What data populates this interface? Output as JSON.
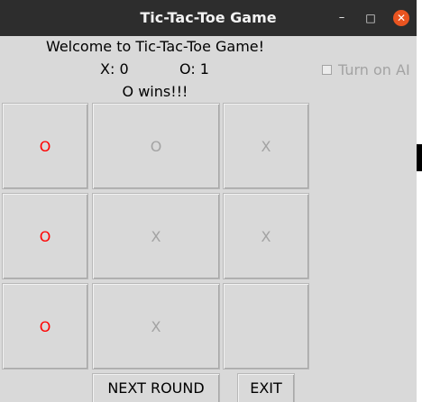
{
  "window": {
    "title": "Tic-Tac-Toe Game",
    "controls": {
      "minimize": "–",
      "maximize": "□",
      "close": "✕"
    }
  },
  "header": {
    "welcome": "Welcome to Tic-Tac-Toe Game!",
    "x_score": "X: 0",
    "o_score": "O: 1",
    "result": "O wins!!!"
  },
  "ai_toggle": {
    "label": "Turn on AI",
    "checked": false
  },
  "board": {
    "cells": [
      {
        "value": "O",
        "winning": true
      },
      {
        "value": "O",
        "winning": false
      },
      {
        "value": "X",
        "winning": false
      },
      {
        "value": "O",
        "winning": true
      },
      {
        "value": "X",
        "winning": false
      },
      {
        "value": "X",
        "winning": false
      },
      {
        "value": "O",
        "winning": true
      },
      {
        "value": "X",
        "winning": false
      },
      {
        "value": "",
        "winning": false
      }
    ]
  },
  "buttons": {
    "next_round": "NEXT ROUND",
    "exit": "EXIT"
  },
  "colors": {
    "winning_mark": "#ff0000",
    "disabled_text": "#a3a3a3",
    "close_button": "#e95420"
  }
}
